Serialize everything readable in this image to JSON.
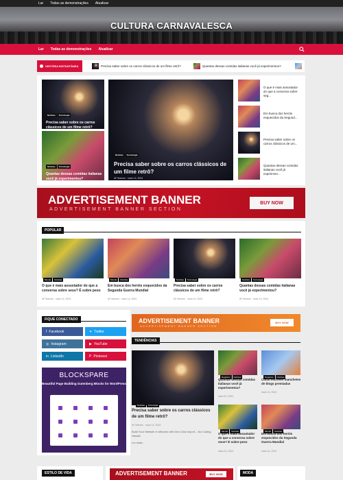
{
  "topbar": {
    "links": [
      "Lar",
      "Todas as demonstrações",
      "Atualizar"
    ]
  },
  "site": {
    "title": "CULTURA CARNAVALESCA"
  },
  "nav": {
    "items": [
      "Lar",
      "Todas as demonstrações",
      "Atualizar"
    ],
    "search_icon": "search-icon"
  },
  "ticker": {
    "label": "HISTÓRIA INSTANTÂNEA",
    "items": [
      "Precisa saber sobre os carros clássicos de um filme retrô?",
      "Quantas dessas comidas italianas você já experimentou?"
    ]
  },
  "featured": {
    "left_top": {
      "tags": [
        "Notícias",
        "Tecnologia"
      ],
      "title": "Precisa saber sobre os carros clássicos de um filme retrô?"
    },
    "left_bottom": {
      "tags": [
        "Notícias",
        "Tecnologia"
      ],
      "title": "Quantas dessas comidas italianas você já experimentou?"
    },
    "main": {
      "tags": [
        "Notícias",
        "Tecnologia"
      ],
      "title": "Precisa saber sobre os carros clássicos de um filme retrô?",
      "author": "AF themes",
      "date": "maio 14, 2024"
    },
    "side": [
      "O que é mais assustador do que a conversa sobre seg...",
      "Em busca dos heróis esquecidos da Segund...",
      "Precisa saber sobre os carros clássicos de um...",
      "Quantas dessas comidas italianas você já experimen..."
    ]
  },
  "ad_big": {
    "title": "ADVERTISEMENT BANNER",
    "subtitle": "ADVERTISEMENT BANNER SECTION",
    "button": "BUY NOW"
  },
  "popular": {
    "heading": "POPULAR",
    "posts": [
      {
        "tags": [
          "Mundo",
          "Notícias"
        ],
        "title": "O que é mais assustador do que a conversa sobre seus? É sobre peso",
        "author": "AF themes",
        "date": "maio 14, 2024"
      },
      {
        "tags": [
          "Mundo",
          "Notícias"
        ],
        "title": "Em busca dos heróis esquecidos da Segunda Guerra Mundial",
        "author": "AF themes",
        "date": "maio 14, 2024"
      },
      {
        "tags": [
          "Notícias",
          "Tecnologia"
        ],
        "title": "Precisa saber sobre os carros clássicos de um filme retrô?",
        "author": "AF themes",
        "date": "maio 14, 2024"
      },
      {
        "tags": [
          "Notícias",
          "Tecnologia"
        ],
        "title": "Quantas dessas comidas italianas você já experimentou?",
        "author": "AF themes",
        "date": "maio 14, 2024"
      }
    ]
  },
  "connected": {
    "heading": "FIQUE CONECTADO",
    "items": [
      {
        "label": "Facebook",
        "color": "#3b5998"
      },
      {
        "label": "Twitter",
        "color": "#1da1f2"
      },
      {
        "label": "Instagram",
        "color": "#3f729b"
      },
      {
        "label": "YouTube",
        "color": "#d7113c"
      },
      {
        "label": "LinkedIn",
        "color": "#0e76a8"
      },
      {
        "label": "Pinterest",
        "color": "#d7113c"
      }
    ]
  },
  "blockspare": {
    "title": "BLOCKSPARE",
    "subtitle": "Beautiful Page Building Gutenberg Blocks for WordPress"
  },
  "ad_small": {
    "title": "ADVERTISEMENT BANNER",
    "subtitle": "ADVERTISEMENT BANNER SECTION",
    "button": "BUY NOW"
  },
  "trending": {
    "heading": "TENDÊNCIAS",
    "main": {
      "tags": [
        "Notícias",
        "Tecnologia"
      ],
      "title": "Precisa saber sobre os carros clássicos de um filme retrô?",
      "author": "AF themes",
      "date": "maio 14, 2024",
      "excerpt": "Build Your Website in Minutes with One-Click Import – No Coding Hassle!",
      "more": "Ler mais..."
    },
    "grid": [
      {
        "tags": [
          "Negócios",
          "Notícias"
        ],
        "title": "Quantas dessas comidas italianas você já experimentou?",
        "date": "maio 14, 2024"
      },
      {
        "tags": [
          "Negócios",
          "Notícias"
        ],
        "title": "Como escrever manchetes de blogs premiadas",
        "date": "maio 14, 2024"
      },
      {
        "tags": [
          "Mundo",
          "Notícias"
        ],
        "title": "O que é mais assustador do que a conversa sobre seus? É sobre peso",
        "date": "maio 14, 2024"
      },
      {
        "tags": [
          "Mundo",
          "Notícias"
        ],
        "title": "Em busca dos heróis esquecidos da Segunda Guerra Mundial",
        "date": "maio 14, 2024"
      }
    ]
  },
  "footer_heads": {
    "left": "ESTILO DE VIDA",
    "ad": "ADVERTISEMENT BANNER",
    "ad_btn": "BUY NOW",
    "right": "MODA"
  }
}
